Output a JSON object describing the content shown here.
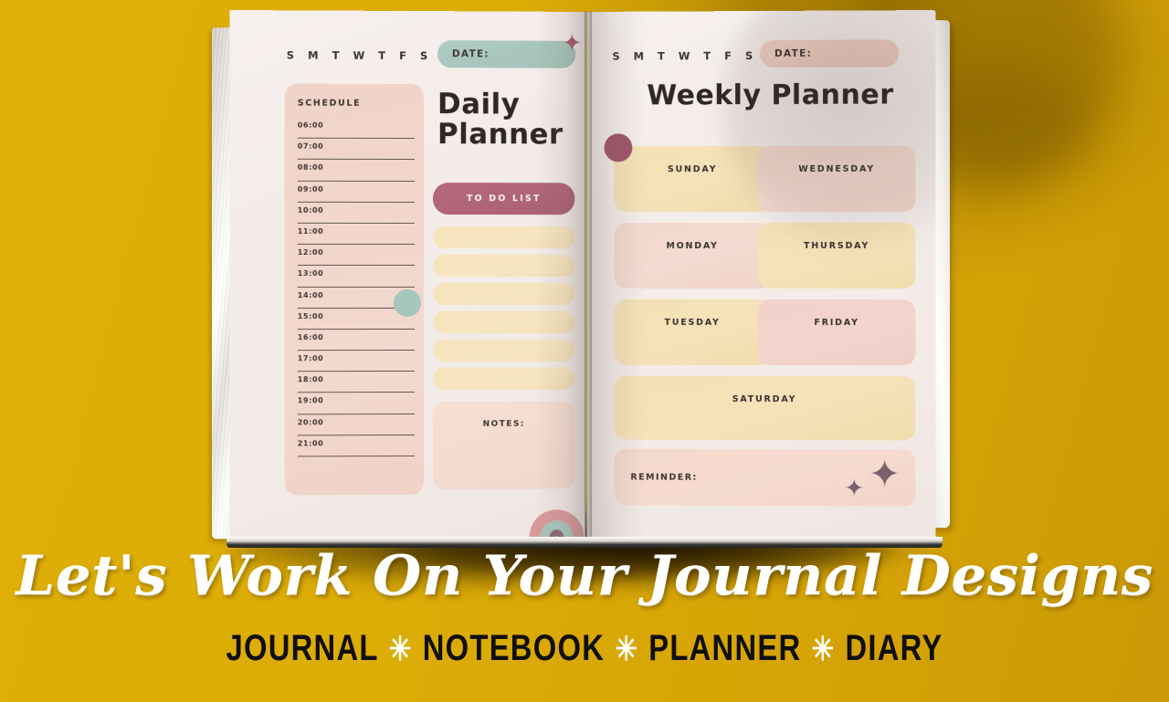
{
  "background": {
    "color": "#dcac07",
    "shadow_color": "#5a3e00"
  },
  "left_page": {
    "weekday_initials": "S M T W T F S",
    "date_label": "DATE:",
    "date_banner_color": "#a7c6bd",
    "star_glyph": "✦",
    "schedule": {
      "title": "SCHEDULE",
      "box_color": "#f2d6cb",
      "times": [
        "06:00",
        "07:00",
        "08:00",
        "09:00",
        "10:00",
        "11:00",
        "12:00",
        "13:00",
        "14:00",
        "15:00",
        "16:00",
        "17:00",
        "18:00",
        "19:00",
        "20:00",
        "21:00"
      ]
    },
    "title_line1": "Daily",
    "title_line2": "Planner",
    "todo": {
      "header_label": "TO DO LIST",
      "header_color": "#b0647a",
      "row_color": "#f6e3bc",
      "row_count": 6
    },
    "notes": {
      "label": "NOTES:",
      "color": "#f5dcd1"
    },
    "teal_dot_color": "#a7c6bd",
    "rainbow": {
      "arc_colors": [
        "#d89a9c",
        "#a7c6bd",
        "#8c6a78"
      ]
    }
  },
  "right_page": {
    "weekday_initials": "S M T W T F S",
    "date_label": "DATE:",
    "date_banner_color": "#f0cfc3",
    "title": "Weekly Planner",
    "maroon_dot_color": "#9c5468",
    "days": [
      {
        "label": "SUNDAY",
        "color": "#f5e2b9",
        "column": "left"
      },
      {
        "label": "MONDAY",
        "color": "#f4dad0",
        "column": "left"
      },
      {
        "label": "TUESDAY",
        "color": "#f5e2b9",
        "column": "left"
      },
      {
        "label": "WEDNESDAY",
        "color": "#f4dad0",
        "column": "right"
      },
      {
        "label": "THURSDAY",
        "color": "#f5e2b9",
        "column": "right"
      },
      {
        "label": "FRIDAY",
        "color": "#f3d5ce",
        "column": "right"
      }
    ],
    "saturday": {
      "label": "SATURDAY",
      "color": "#f5e2b9"
    },
    "reminder": {
      "label": "REMINDER:",
      "color": "#f6dbd0",
      "sparkle_glyph": "✦",
      "sparkle_color": "#7b6070"
    }
  },
  "captions": {
    "script_line": "Let's Work On Your Journal Designs",
    "tagline_items": [
      "JOURNAL",
      "NOTEBOOK",
      "PLANNER",
      "DIARY"
    ],
    "tagline_separator": "✳",
    "tagline_color": "#100f0c",
    "separator_color": "#ffffff",
    "script_color": "#ffffff"
  }
}
